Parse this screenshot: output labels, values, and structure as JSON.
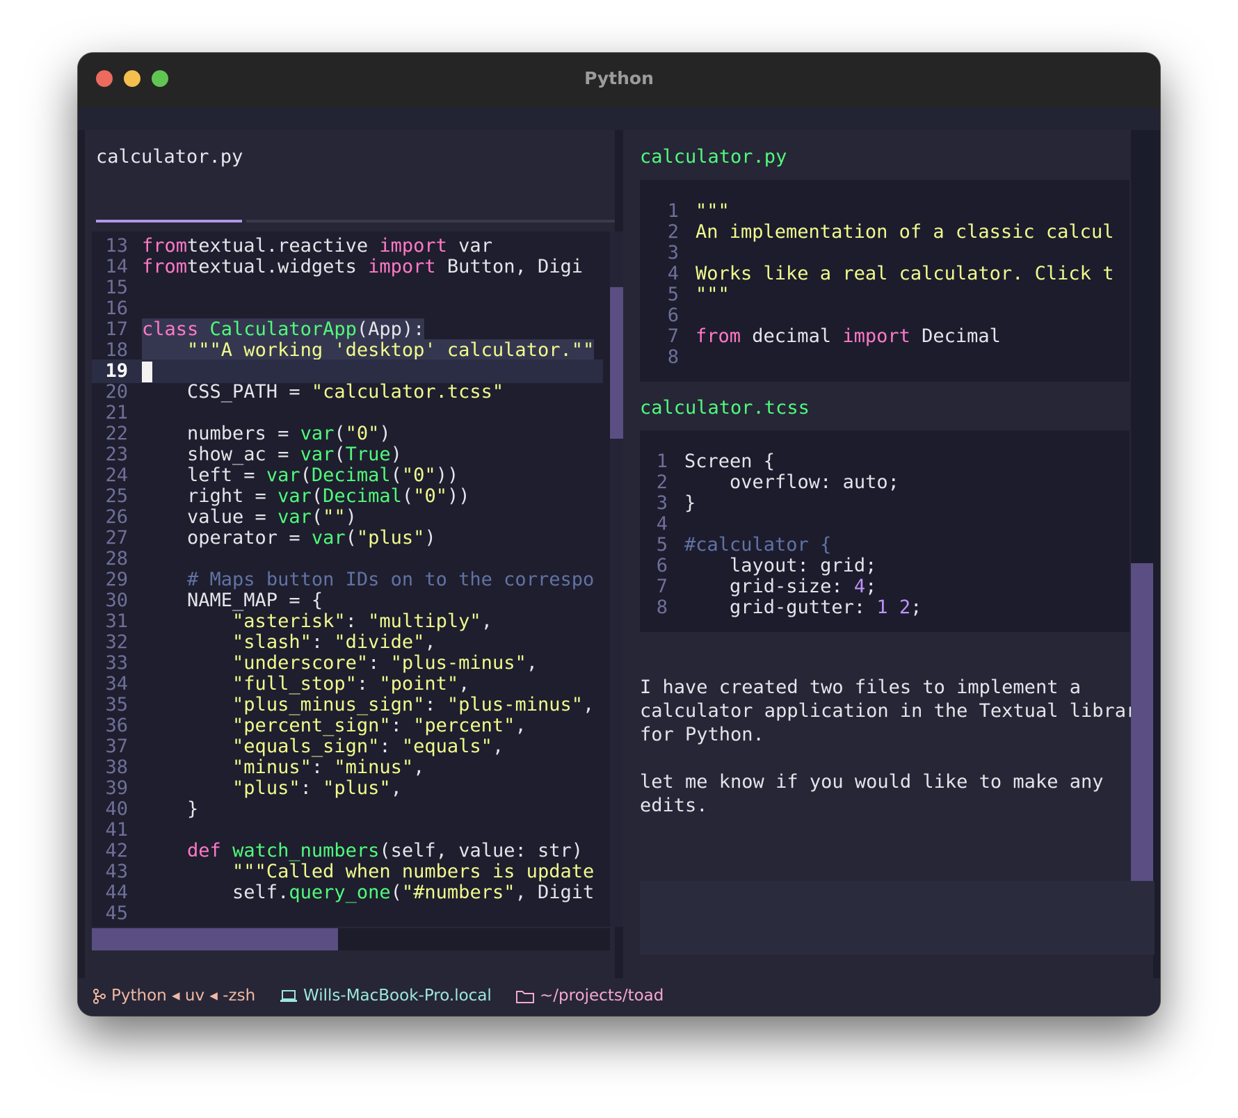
{
  "window": {
    "title": "Python"
  },
  "editor": {
    "tab_label": "calculator.py",
    "lines": [
      {
        "n": "13",
        "segs": [
          [
            "kw",
            "from"
          ],
          [
            "",
            "textual.reactive "
          ],
          [
            "kw",
            "import"
          ],
          [
            "",
            " var"
          ]
        ]
      },
      {
        "n": "14",
        "segs": [
          [
            "kw",
            "from"
          ],
          [
            "",
            "textual.widgets "
          ],
          [
            "kw",
            "import"
          ],
          [
            "",
            " Button, Digi"
          ]
        ]
      },
      {
        "n": "15",
        "segs": []
      },
      {
        "n": "16",
        "segs": []
      },
      {
        "n": "17",
        "segs": [
          [
            "kw",
            "class"
          ],
          [
            "",
            " "
          ],
          [
            "fn",
            "CalculatorApp"
          ],
          [
            "",
            "(App):"
          ]
        ],
        "selected": true
      },
      {
        "n": "18",
        "segs": [
          [
            "",
            "    "
          ],
          [
            "st",
            "\"\"\"A working 'desktop' calculator.\"\""
          ]
        ],
        "selected": true
      },
      {
        "n": "19",
        "segs": [],
        "cursor": true
      },
      {
        "n": "20",
        "segs": [
          [
            "",
            "    CSS_PATH = "
          ],
          [
            "st",
            "\"calculator.tcss\""
          ]
        ]
      },
      {
        "n": "21",
        "segs": []
      },
      {
        "n": "22",
        "segs": [
          [
            "",
            "    numbers = "
          ],
          [
            "fn",
            "var"
          ],
          [
            "",
            "("
          ],
          [
            "st",
            "\"0\""
          ],
          [
            "",
            ")"
          ]
        ]
      },
      {
        "n": "23",
        "segs": [
          [
            "",
            "    show_ac = "
          ],
          [
            "fn",
            "var"
          ],
          [
            "",
            "("
          ],
          [
            "fn",
            "True"
          ],
          [
            "",
            ")"
          ]
        ]
      },
      {
        "n": "24",
        "segs": [
          [
            "",
            "    left = "
          ],
          [
            "fn",
            "var"
          ],
          [
            "",
            "("
          ],
          [
            "fn",
            "Decimal"
          ],
          [
            "",
            "("
          ],
          [
            "st",
            "\"0\""
          ],
          [
            "",
            "))"
          ]
        ]
      },
      {
        "n": "25",
        "segs": [
          [
            "",
            "    right = "
          ],
          [
            "fn",
            "var"
          ],
          [
            "",
            "("
          ],
          [
            "fn",
            "Decimal"
          ],
          [
            "",
            "("
          ],
          [
            "st",
            "\"0\""
          ],
          [
            "",
            "))"
          ]
        ]
      },
      {
        "n": "26",
        "segs": [
          [
            "",
            "    value = "
          ],
          [
            "fn",
            "var"
          ],
          [
            "",
            "("
          ],
          [
            "st",
            "\"\""
          ],
          [
            "",
            ")"
          ]
        ]
      },
      {
        "n": "27",
        "segs": [
          [
            "",
            "    operator = "
          ],
          [
            "fn",
            "var"
          ],
          [
            "",
            "("
          ],
          [
            "st",
            "\"plus\""
          ],
          [
            "",
            ")"
          ]
        ]
      },
      {
        "n": "28",
        "segs": []
      },
      {
        "n": "29",
        "segs": [
          [
            "",
            "    "
          ],
          [
            "cm",
            "# Maps button IDs on to the correspo"
          ]
        ]
      },
      {
        "n": "30",
        "segs": [
          [
            "",
            "    NAME_MAP = {"
          ]
        ]
      },
      {
        "n": "31",
        "segs": [
          [
            "",
            "        "
          ],
          [
            "st",
            "\"asterisk\""
          ],
          [
            "",
            ": "
          ],
          [
            "st",
            "\"multiply\""
          ],
          [
            "",
            ","
          ]
        ]
      },
      {
        "n": "32",
        "segs": [
          [
            "",
            "        "
          ],
          [
            "st",
            "\"slash\""
          ],
          [
            "",
            ": "
          ],
          [
            "st",
            "\"divide\""
          ],
          [
            "",
            ","
          ]
        ]
      },
      {
        "n": "33",
        "segs": [
          [
            "",
            "        "
          ],
          [
            "st",
            "\"underscore\""
          ],
          [
            "",
            ": "
          ],
          [
            "st",
            "\"plus-minus\""
          ],
          [
            "",
            ","
          ]
        ]
      },
      {
        "n": "34",
        "segs": [
          [
            "",
            "        "
          ],
          [
            "st",
            "\"full_stop\""
          ],
          [
            "",
            ": "
          ],
          [
            "st",
            "\"point\""
          ],
          [
            "",
            ","
          ]
        ]
      },
      {
        "n": "35",
        "segs": [
          [
            "",
            "        "
          ],
          [
            "st",
            "\"plus_minus_sign\""
          ],
          [
            "",
            ": "
          ],
          [
            "st",
            "\"plus-minus\""
          ],
          [
            "",
            ","
          ]
        ]
      },
      {
        "n": "36",
        "segs": [
          [
            "",
            "        "
          ],
          [
            "st",
            "\"percent_sign\""
          ],
          [
            "",
            ": "
          ],
          [
            "st",
            "\"percent\""
          ],
          [
            "",
            ","
          ]
        ]
      },
      {
        "n": "37",
        "segs": [
          [
            "",
            "        "
          ],
          [
            "st",
            "\"equals_sign\""
          ],
          [
            "",
            ": "
          ],
          [
            "st",
            "\"equals\""
          ],
          [
            "",
            ","
          ]
        ]
      },
      {
        "n": "38",
        "segs": [
          [
            "",
            "        "
          ],
          [
            "st",
            "\"minus\""
          ],
          [
            "",
            ": "
          ],
          [
            "st",
            "\"minus\""
          ],
          [
            "",
            ","
          ]
        ]
      },
      {
        "n": "39",
        "segs": [
          [
            "",
            "        "
          ],
          [
            "st",
            "\"plus\""
          ],
          [
            "",
            ": "
          ],
          [
            "st",
            "\"plus\""
          ],
          [
            "",
            ","
          ]
        ]
      },
      {
        "n": "40",
        "segs": [
          [
            "",
            "    }"
          ]
        ]
      },
      {
        "n": "41",
        "segs": []
      },
      {
        "n": "42",
        "segs": [
          [
            "",
            "    "
          ],
          [
            "kw",
            "def"
          ],
          [
            "",
            " "
          ],
          [
            "fn",
            "watch_numbers"
          ],
          [
            "",
            "(self, value: str)"
          ]
        ]
      },
      {
        "n": "43",
        "segs": [
          [
            "",
            "        "
          ],
          [
            "st",
            "\"\"\"Called when numbers is update"
          ]
        ]
      },
      {
        "n": "44",
        "segs": [
          [
            "",
            "        self."
          ],
          [
            "fn",
            "query_one"
          ],
          [
            "",
            "("
          ],
          [
            "st",
            "\"#numbers\""
          ],
          [
            "",
            ", Digit"
          ]
        ]
      },
      {
        "n": "45",
        "segs": []
      }
    ]
  },
  "chat": {
    "blocks": [
      {
        "file": "calculator.py",
        "lines": [
          {
            "n": "1",
            "segs": [
              [
                "st",
                "\"\"\""
              ]
            ]
          },
          {
            "n": "2",
            "segs": [
              [
                "st",
                "An implementation of a classic calcul"
              ]
            ]
          },
          {
            "n": "3",
            "segs": []
          },
          {
            "n": "4",
            "segs": [
              [
                "st",
                "Works like a real calculator. Click t"
              ]
            ]
          },
          {
            "n": "5",
            "segs": [
              [
                "st",
                "\"\"\""
              ]
            ]
          },
          {
            "n": "6",
            "segs": []
          },
          {
            "n": "7",
            "segs": [
              [
                "kw",
                "from"
              ],
              [
                "",
                " decimal "
              ],
              [
                "kw",
                "import"
              ],
              [
                "",
                " Decimal"
              ]
            ]
          },
          {
            "n": "8",
            "segs": []
          }
        ]
      },
      {
        "file": "calculator.tcss",
        "lines": [
          {
            "n": "1",
            "segs": [
              [
                "",
                "Screen {"
              ]
            ]
          },
          {
            "n": "2",
            "segs": [
              [
                "",
                "    overflow: auto;"
              ]
            ]
          },
          {
            "n": "3",
            "segs": [
              [
                "",
                "}"
              ]
            ]
          },
          {
            "n": "4",
            "segs": []
          },
          {
            "n": "5",
            "segs": [
              [
                "cm",
                "#calculator {"
              ]
            ]
          },
          {
            "n": "6",
            "segs": [
              [
                "",
                "    layout: grid;"
              ]
            ]
          },
          {
            "n": "7",
            "segs": [
              [
                "",
                "    grid-size: "
              ],
              [
                "nm",
                "4"
              ],
              [
                "",
                ";"
              ]
            ]
          },
          {
            "n": "8",
            "segs": [
              [
                "",
                "    grid-gutter: "
              ],
              [
                "nm",
                "1"
              ],
              [
                "",
                " "
              ],
              [
                "nm",
                "2"
              ],
              [
                "",
                ";"
              ]
            ]
          }
        ]
      }
    ],
    "message": "I have created two files to implement a\ncalculator application in the Textual library\nfor Python.\n\nlet me know if you would like to make any\nedits."
  },
  "status_bar": {
    "process": "Python ◂ uv ◂ -zsh",
    "host": "Wills-MacBook-Pro.local",
    "cwd": "~/projects/toad",
    "icons": [
      "git-branch-icon",
      "laptop-icon",
      "folder-icon"
    ]
  },
  "colors": {
    "keyword": "#ff79c6",
    "function": "#50fa7b",
    "string": "#f1fa8c",
    "comment": "#6272a4",
    "number": "#bd93f9",
    "accent": "#b296e6"
  }
}
